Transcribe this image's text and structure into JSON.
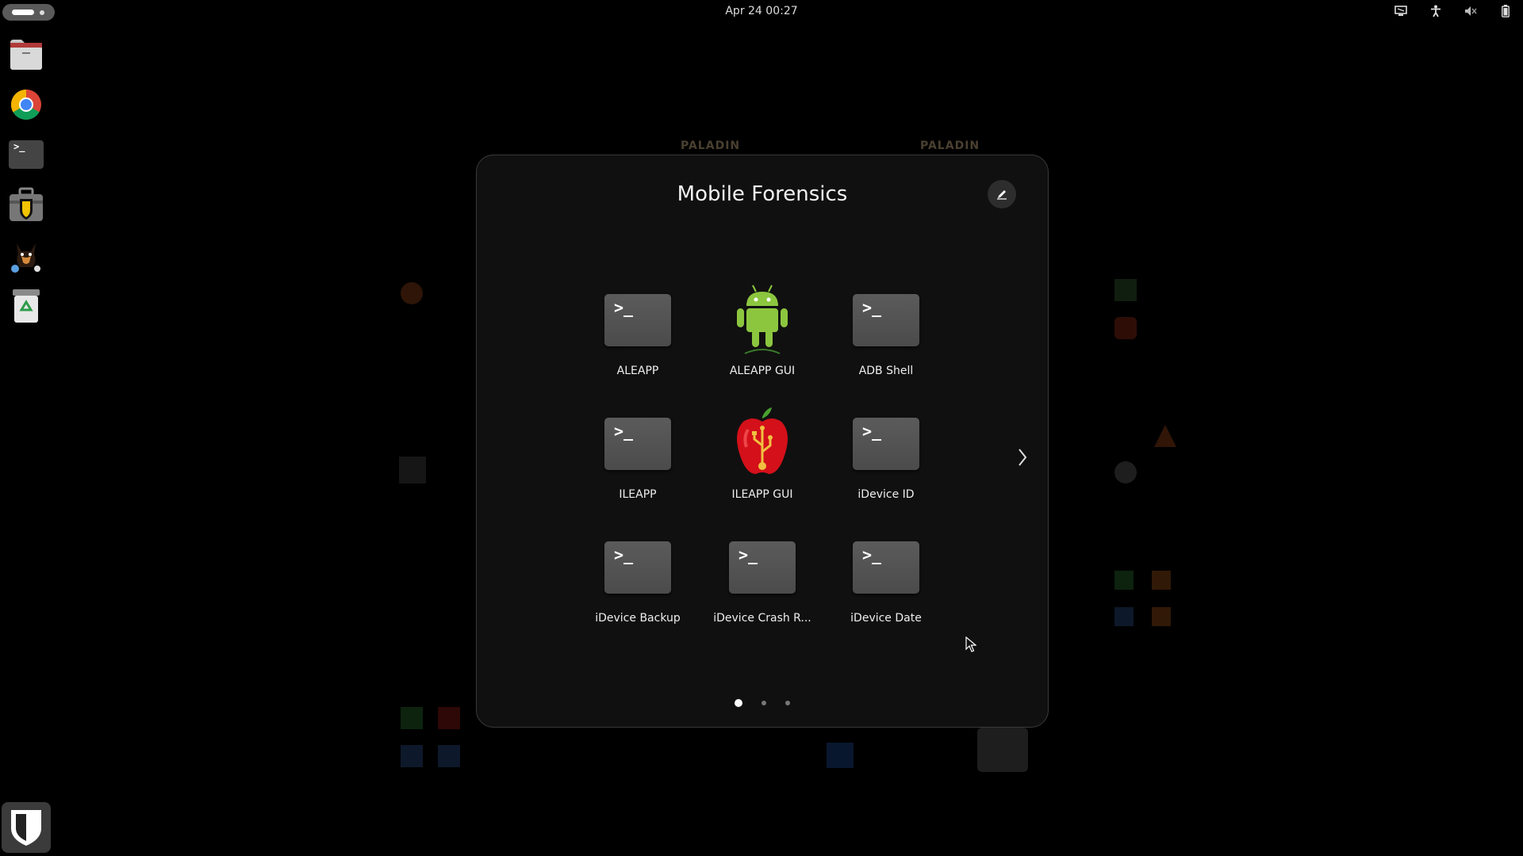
{
  "topbar": {
    "clock": "Apr 24  00:27",
    "tray_icons": [
      "network-icon",
      "accessibility-icon",
      "volume-muted-icon",
      "battery-icon"
    ]
  },
  "dock": {
    "items": [
      {
        "name": "files-icon"
      },
      {
        "name": "chrome-icon"
      },
      {
        "name": "terminal-icon"
      },
      {
        "name": "paladin-toolbox-icon"
      },
      {
        "name": "autopsy-icon"
      },
      {
        "name": "trash-icon"
      }
    ],
    "bottom_item": "paladin-shield-icon"
  },
  "background_logos": [
    "PALADIN",
    "PALADIN"
  ],
  "folder": {
    "title": "Mobile Forensics",
    "apps": [
      {
        "label": "ALEAPP",
        "icon": "terminal-app-icon"
      },
      {
        "label": "ALEAPP GUI",
        "icon": "android-robot-icon"
      },
      {
        "label": "ADB Shell",
        "icon": "terminal-app-icon"
      },
      {
        "label": "ILEAPP",
        "icon": "terminal-app-icon"
      },
      {
        "label": "ILEAPP GUI",
        "icon": "apple-usb-icon"
      },
      {
        "label": "iDevice ID",
        "icon": "terminal-app-icon"
      },
      {
        "label": "iDevice Backup",
        "icon": "terminal-app-icon"
      },
      {
        "label": "iDevice Crash R...",
        "icon": "terminal-app-icon"
      },
      {
        "label": "iDevice Date",
        "icon": "terminal-app-icon"
      }
    ],
    "terminal_glyph": ">_",
    "pages": 3,
    "current_page": 1
  },
  "colors": {
    "background": "#000000",
    "folder_bg": "#101010",
    "accent_android": "#8cc63f",
    "accent_apple": "#d4101a"
  }
}
